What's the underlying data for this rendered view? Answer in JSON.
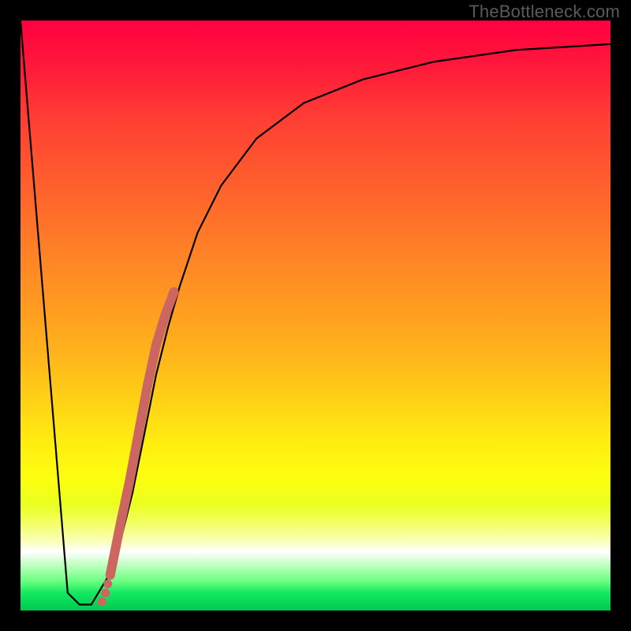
{
  "watermark": "TheBottleneck.com",
  "chart_data": {
    "type": "line",
    "title": "",
    "xlabel": "",
    "ylabel": "",
    "xlim": [
      0,
      100
    ],
    "ylim": [
      0,
      100
    ],
    "gradient_stops": [
      {
        "pos": 0.0,
        "color": "#ff0040"
      },
      {
        "pos": 0.5,
        "color": "#ffa81e"
      },
      {
        "pos": 0.78,
        "color": "#fcff10"
      },
      {
        "pos": 0.9,
        "color": "#ffffff"
      },
      {
        "pos": 1.0,
        "color": "#00c94e"
      }
    ],
    "series": [
      {
        "name": "bottleneck-curve",
        "x": [
          0,
          8,
          10,
          12,
          15,
          17,
          19,
          21,
          23,
          25,
          27,
          30,
          34,
          40,
          48,
          58,
          70,
          84,
          100
        ],
        "y": [
          100,
          3,
          1,
          1,
          6,
          12,
          20,
          30,
          40,
          48,
          55,
          64,
          72,
          80,
          86,
          90,
          93,
          95,
          96
        ]
      }
    ],
    "highlight_segment": {
      "name": "marker-band",
      "x": [
        15.2,
        16.0,
        17.0,
        18.5,
        20.0,
        21.5,
        23.0,
        24.5,
        26.0
      ],
      "y": [
        6.0,
        10.0,
        15.0,
        22.0,
        30.0,
        38.0,
        45.0,
        50.0,
        54.0
      ]
    },
    "dots": {
      "name": "marker-dots",
      "x": [
        13.8,
        14.4,
        14.8,
        15.2
      ],
      "y": [
        1.5,
        3.0,
        4.5,
        6.0
      ]
    }
  }
}
